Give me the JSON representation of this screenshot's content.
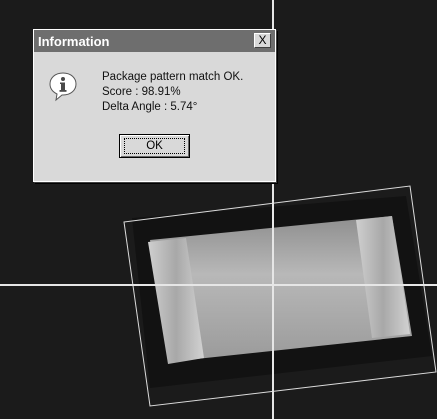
{
  "dialog": {
    "title": "Information",
    "close_glyph": "X",
    "icon": "information-icon",
    "message_lines": [
      "Package pattern match OK.",
      "Score : 98.91%",
      "Delta Angle : 5.74°"
    ],
    "ok_label": "OK"
  },
  "inspection": {
    "score_percent": 98.91,
    "delta_angle_deg": 5.74
  },
  "colors": {
    "viewport_background": "#1b1b1b",
    "crosshair": "#e6e6e6",
    "match_box": "#dcdcdc",
    "dialog_face": "#d9d9d9",
    "titlebar": "#6e6e6e"
  }
}
